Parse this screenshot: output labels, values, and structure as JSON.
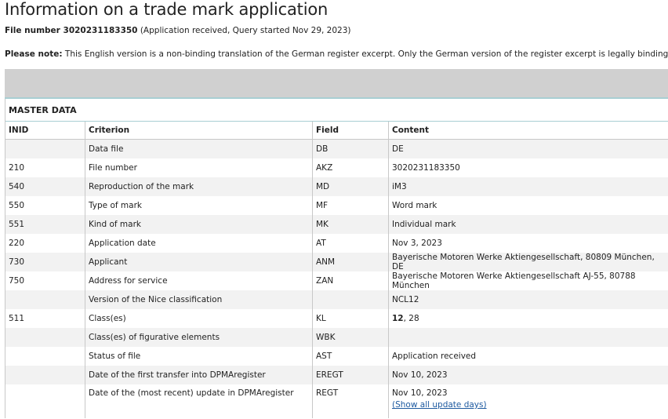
{
  "header": {
    "title": "Information on a trade mark application",
    "file_number_label": "File number 3020231183350",
    "file_number_detail": " (Application received, Query started Nov 29, 2023)",
    "note_label": "Please note:",
    "note_text": " This English version is a non-binding translation of the German register excerpt. Only the German version of the register excerpt is legally binding."
  },
  "section": {
    "title": "MASTER DATA"
  },
  "table": {
    "headers": {
      "inid": "INID",
      "criterion": "Criterion",
      "field": "Field",
      "content": "Content"
    },
    "rows": [
      {
        "inid": "",
        "criterion": "Data file",
        "field": "DB",
        "content": "DE"
      },
      {
        "inid": "210",
        "criterion": "File number",
        "field": "AKZ",
        "content": "3020231183350"
      },
      {
        "inid": "540",
        "criterion": "Reproduction of the mark",
        "field": "MD",
        "content": "iM3"
      },
      {
        "inid": "550",
        "criterion": "Type of mark",
        "field": "MF",
        "content": "Word mark"
      },
      {
        "inid": "551",
        "criterion": "Kind of mark",
        "field": "MK",
        "content": "Individual mark"
      },
      {
        "inid": "220",
        "criterion": "Application date",
        "field": "AT",
        "content": "Nov 3, 2023"
      },
      {
        "inid": "730",
        "criterion": "Applicant",
        "field": "ANM",
        "content": "Bayerische Motoren Werke Aktiengesellschaft, 80809 München, DE"
      },
      {
        "inid": "750",
        "criterion": "Address for service",
        "field": "ZAN",
        "content": "Bayerische Motoren Werke Aktiengesellschaft AJ-55, 80788 München"
      },
      {
        "inid": "",
        "criterion": "Version of the Nice classification",
        "field": "",
        "content": "NCL12"
      },
      {
        "inid": "511",
        "criterion": "Class(es)",
        "field": "KL",
        "content_bold": "12",
        "content_rest": ", 28"
      },
      {
        "inid": "",
        "criterion": "Class(es) of figurative elements",
        "field": "WBK",
        "content": ""
      },
      {
        "inid": "",
        "criterion": "Status of file",
        "field": "AST",
        "content": "Application received"
      },
      {
        "inid": "",
        "criterion": "Date of the first transfer into DPMAregister",
        "field": "EREGT",
        "content": "Nov 10, 2023"
      },
      {
        "inid": "",
        "criterion": "Date of the (most recent) update in DPMAregister",
        "field": "REGT",
        "content": "Nov 10, 2023",
        "link": "(Show all update days)"
      }
    ]
  }
}
